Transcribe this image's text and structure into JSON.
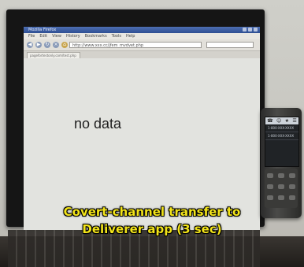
{
  "browser": {
    "window_title": "Mozilla Firefox",
    "menu": [
      "File",
      "Edit",
      "View",
      "History",
      "Bookmarks",
      "Tools",
      "Help"
    ],
    "url": "http://www.xxx.cc/jfem_mvdvet.php",
    "tab_title": "pagefortestonly.com/test.php"
  },
  "page": {
    "message": "no data"
  },
  "phone": {
    "icons": [
      "phone-icon",
      "contacts-icon",
      "star-icon",
      "log-icon"
    ],
    "calls": [
      "1-800-XXX-XXXX",
      "1-800-XXX-XXXX"
    ]
  },
  "caption": {
    "line1": "Covert-channel transfer to",
    "line2": "Deliverer app (3 sec)"
  },
  "colors": {
    "caption": "#f2e419",
    "screen_bg": "#e2e3df",
    "titlebar": "#2f4f93"
  }
}
